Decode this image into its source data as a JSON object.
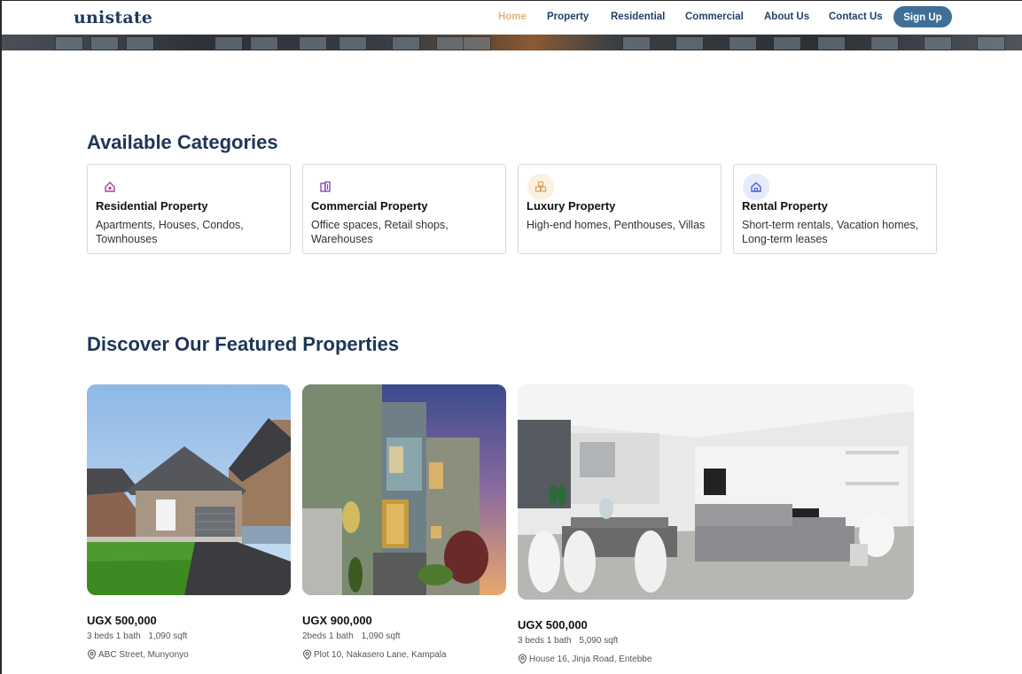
{
  "header": {
    "logo": "unistate",
    "nav": [
      {
        "label": "Home",
        "active": true
      },
      {
        "label": "Property",
        "active": false
      },
      {
        "label": "Residential",
        "active": false
      },
      {
        "label": "Commercial",
        "active": false
      },
      {
        "label": "About Us",
        "active": false
      },
      {
        "label": "Contact Us",
        "active": false
      }
    ],
    "signup_label": "Sign Up"
  },
  "categories": {
    "title": "Available Categories",
    "items": [
      {
        "icon": "house-heart-icon",
        "name": "Residential Property",
        "description": "Apartments, Houses, Condos, Townhouses"
      },
      {
        "icon": "building-icon",
        "name": "Commercial Property",
        "description": "Office spaces, Retail shops, Warehouses"
      },
      {
        "icon": "boxes-icon",
        "name": "Luxury Property",
        "description": "High-end homes, Penthouses, Villas"
      },
      {
        "icon": "home-icon",
        "name": "Rental Property",
        "description": "Short-term rentals, Vacation homes, Long-term leases"
      }
    ]
  },
  "featured": {
    "title": "Discover Our Featured Properties",
    "properties": [
      {
        "price": "UGX 500,000",
        "beds": "3 beds 1 bath",
        "area": "1,090 sqft",
        "location": "ABC Street, Munyonyo",
        "image": "suburban-house-photo"
      },
      {
        "price": "UGX 900,000",
        "beds": "2beds 1 bath",
        "area": "1,090 sqft",
        "location": "Plot 10, Nakasero Lane, Kampala",
        "image": "modern-house-dusk-photo"
      },
      {
        "price": "UGX 500,000",
        "beds": "3 beds 1 bath",
        "area": "5,090 sqft",
        "location": "House 16, Jinja Road, Entebbe",
        "image": "living-dining-interior-photo"
      }
    ]
  },
  "colors": {
    "brand": "#1e3a5f",
    "nav_active": "#e0b57a",
    "signup_bg": "#3f6f95"
  }
}
